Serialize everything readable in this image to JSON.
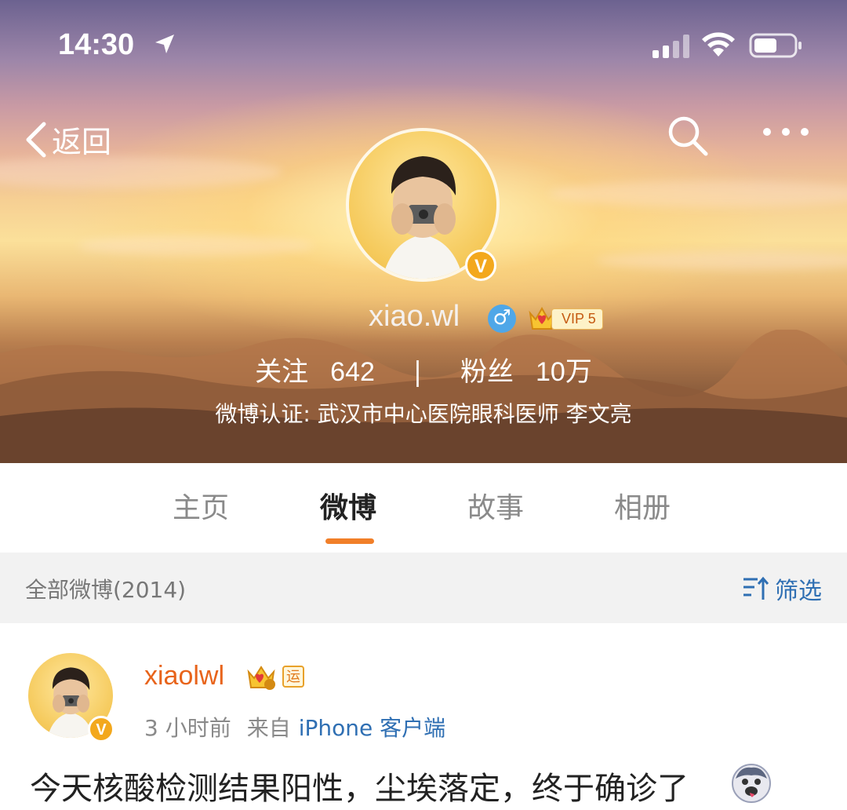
{
  "status_bar": {
    "time": "14:30"
  },
  "nav": {
    "back_label": "返回"
  },
  "profile": {
    "name": "xiao.wl",
    "gender_symbol": "♂",
    "vip_label": "VIP 5",
    "following_label": "关注",
    "following_count": "642",
    "separator": "|",
    "fans_label": "粉丝",
    "fans_count": "10万",
    "verification": "微博认证: 武汉市中心医院眼科医师 李文亮",
    "verified_badge": "V"
  },
  "tabs": [
    {
      "label": "主页",
      "active": false
    },
    {
      "label": "微博",
      "active": true
    },
    {
      "label": "故事",
      "active": false
    },
    {
      "label": "相册",
      "active": false
    }
  ],
  "filter_bar": {
    "count_label": "全部微博(2014)",
    "filter_label": "筛选"
  },
  "post": {
    "username": "xiaolwl",
    "badge_yun": "运",
    "time": "3 小时前",
    "from_label": "来自",
    "source": "iPhone 客户端",
    "text": "今天核酸检测结果阳性，尘埃落定，终于确诊了",
    "verified_badge": "V"
  },
  "colors": {
    "accent_orange": "#f17f29",
    "link_blue": "#2f6fb3",
    "username_orange": "#e8641b",
    "verified_gold": "#f3a81d"
  },
  "icons": [
    "location-arrow-icon",
    "signal-icon",
    "wifi-icon",
    "battery-icon",
    "back-chevron-icon",
    "search-icon",
    "more-icon",
    "gender-male-icon",
    "vip-crown-icon",
    "filter-icon",
    "emoji-icon"
  ]
}
